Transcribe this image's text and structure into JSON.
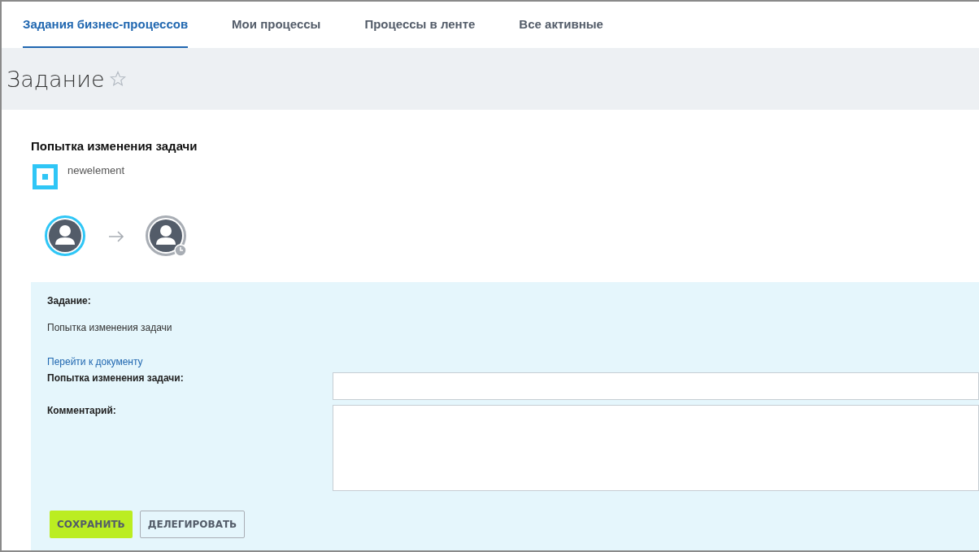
{
  "tabs": [
    {
      "label": "Задания бизнес-процессов",
      "selected": true
    },
    {
      "label": "Мои процессы",
      "selected": false
    },
    {
      "label": "Процессы в ленте",
      "selected": false
    },
    {
      "label": "Все активные",
      "selected": false
    }
  ],
  "page_title": "Задание",
  "favorite": false,
  "task": {
    "title": "Попытка изменения задачи",
    "document": "newelement",
    "participants": [
      {
        "kind": "current"
      },
      {
        "kind": "waiting"
      }
    ]
  },
  "form": {
    "task_label": "Задание:",
    "task_text": "Попытка изменения задачи",
    "link": "Перейти к документу",
    "fields": [
      {
        "kind": "input",
        "label": "Попытка изменения задачи:"
      },
      {
        "kind": "textarea",
        "label": "Комментарий:"
      }
    ],
    "buttons": [
      {
        "label": "СОХРАНИТЬ",
        "kind": "primary"
      },
      {
        "label": "ДЕЛЕГИРОВАТЬ",
        "kind": "secondary"
      }
    ]
  }
}
